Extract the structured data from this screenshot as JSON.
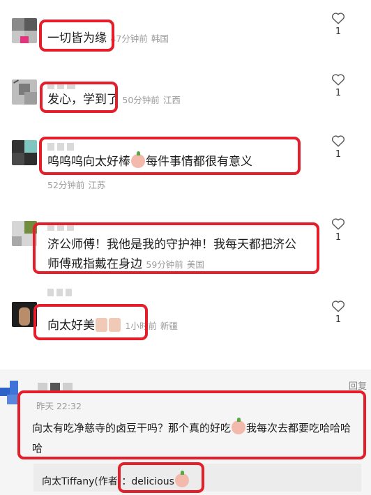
{
  "comments": [
    {
      "text": "一切皆为缘",
      "time": "47分钟前",
      "region": "韩国",
      "likes": "1"
    },
    {
      "text": "发心，学到了",
      "time": "50分钟前",
      "region": "江西",
      "likes": "1"
    },
    {
      "text_before": "呜呜呜向太好棒",
      "text_after": "每件事情都很有意义",
      "time": "52分钟前",
      "region": "江苏",
      "likes": "1"
    },
    {
      "line1": "济公师傅！我他是我的守护神！我每天都把济公",
      "line2": "师傅戒指戴在身边",
      "time": "59分钟前",
      "region": "美国",
      "likes": "1"
    },
    {
      "text": "向太好美",
      "time": "1小时前",
      "region": "新疆",
      "likes": "1"
    }
  ],
  "thread": {
    "reply_label": "回复",
    "time": "昨天 22:32",
    "line1_before": "向太有吃净慈寺的卤豆干吗？那个真的好吃",
    "line1_after": "我每次去都要吃哈哈哈",
    "line2": "哈",
    "author_reply": {
      "name": "向太Tiffany(作者)",
      "separator": "：",
      "text": "delicious"
    }
  },
  "icons": {
    "like": "heart-outline-icon",
    "emoji_peach": "peach-emoji-icon",
    "emoji_face": "face-emoji-icon"
  },
  "colors": {
    "highlight": "#e41e2a",
    "meta": "#9b9b9b",
    "thread_bg": "#f5f5f5"
  }
}
